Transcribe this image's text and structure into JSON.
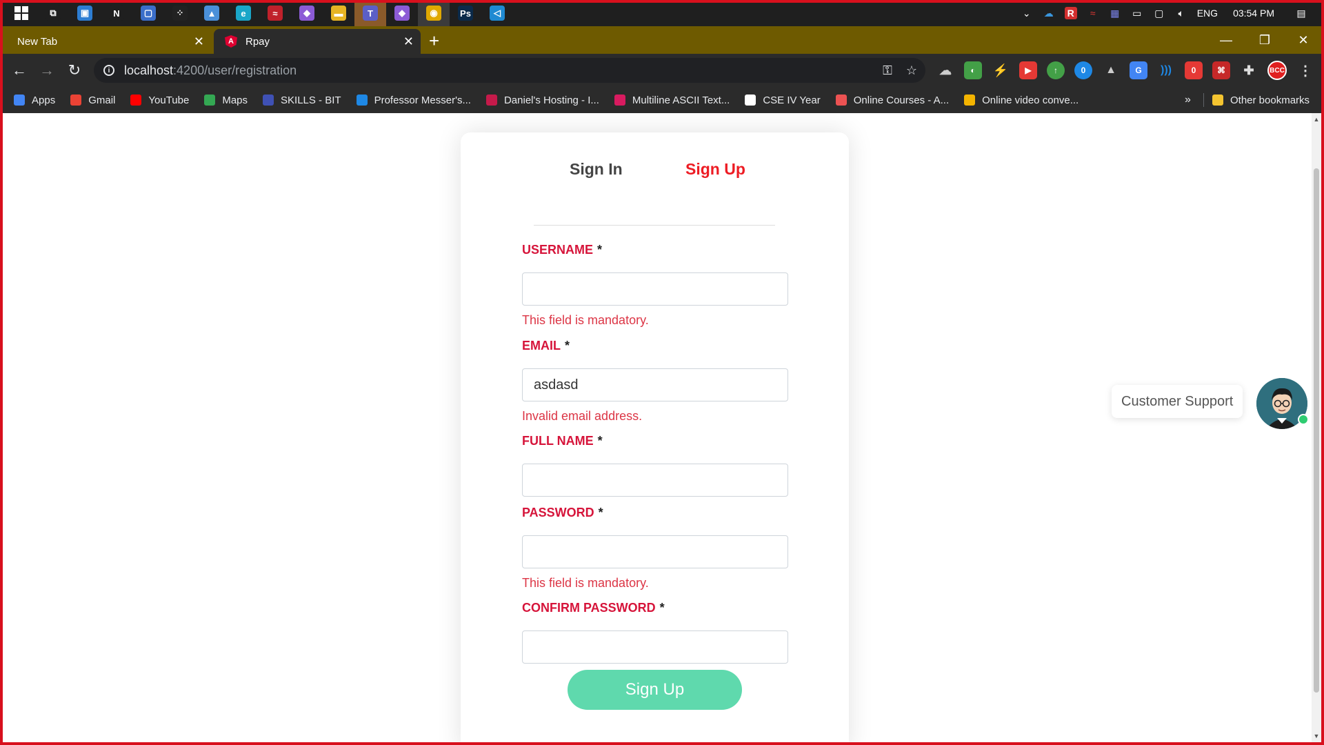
{
  "taskbar": {
    "apps": [
      {
        "icon": "task-view-icon",
        "color": "#1f1f1f",
        "glyph": "⧉"
      },
      {
        "icon": "app-blue-icon",
        "color": "#2d7dd2",
        "glyph": "▣"
      },
      {
        "icon": "notion-icon",
        "color": "#1f1f1f",
        "glyph": "N"
      },
      {
        "icon": "app-device-icon",
        "color": "#3b6ec9",
        "glyph": "▢"
      },
      {
        "icon": "blackberry-icon",
        "color": "#222",
        "glyph": "⁘"
      },
      {
        "icon": "photos-icon",
        "color": "#4a90d9",
        "glyph": "▲"
      },
      {
        "icon": "edge-icon",
        "color": "#1aa6c8",
        "glyph": "e"
      },
      {
        "icon": "app-red-icon",
        "color": "#c0212b",
        "glyph": "≈"
      },
      {
        "icon": "visual-studio-icon",
        "color": "#8c5bd6",
        "glyph": "◆"
      },
      {
        "icon": "file-explorer-icon",
        "color": "#e7b424",
        "glyph": "▬"
      },
      {
        "icon": "teams-icon",
        "color": "#5b5fc7",
        "glyph": "T"
      },
      {
        "icon": "visual-studio-icon",
        "color": "#8c5bd6",
        "glyph": "◆"
      },
      {
        "icon": "chrome-icon",
        "color": "#e0a800",
        "glyph": "◉"
      },
      {
        "icon": "photoshop-icon",
        "color": "#0b2a4a",
        "glyph": "Ps"
      },
      {
        "icon": "vscode-icon",
        "color": "#1f8ad2",
        "glyph": "◁"
      }
    ],
    "lang": "ENG",
    "time": "03:54 PM"
  },
  "browser": {
    "tabs": [
      {
        "title": "New Tab"
      },
      {
        "title": "Rpay"
      }
    ],
    "url_host": "localhost",
    "url_path": ":4200/user/registration",
    "bookmarks": [
      {
        "label": "Apps",
        "icon": "apps-grid-icon",
        "color": "#4285f4"
      },
      {
        "label": "Gmail",
        "icon": "gmail-icon",
        "color": "#ea4335"
      },
      {
        "label": "YouTube",
        "icon": "youtube-icon",
        "color": "#ff0000"
      },
      {
        "label": "Maps",
        "icon": "maps-icon",
        "color": "#34a853"
      },
      {
        "label": "SKILLS - BIT",
        "icon": "skills-icon",
        "color": "#3f51b5"
      },
      {
        "label": "Professor Messer's...",
        "icon": "messer-icon",
        "color": "#1e88e5"
      },
      {
        "label": "Daniel's Hosting - I...",
        "icon": "raspberry-icon",
        "color": "#c51a4a"
      },
      {
        "label": "Multiline ASCII Text...",
        "icon": "ascii-icon",
        "color": "#d81b60"
      },
      {
        "label": "CSE IV Year",
        "icon": "google-icon",
        "color": "#ffffff"
      },
      {
        "label": "Online Courses - A...",
        "icon": "udemy-icon",
        "color": "#ec5252"
      },
      {
        "label": "Online video conve...",
        "icon": "video-converter-icon",
        "color": "#f4b400"
      }
    ],
    "other_bookmarks": "Other bookmarks",
    "more": "»"
  },
  "form": {
    "tab_signin": "Sign In",
    "tab_signup": "Sign Up",
    "fields": [
      {
        "label": "USERNAME",
        "value": "",
        "error": "This field is mandatory."
      },
      {
        "label": "EMAIL",
        "value": "asdasd",
        "error": "Invalid email address."
      },
      {
        "label": "FULL NAME",
        "value": "",
        "error": ""
      },
      {
        "label": "PASSWORD",
        "value": "",
        "error": "This field is mandatory."
      },
      {
        "label": "CONFIRM PASSWORD",
        "value": "",
        "error": ""
      }
    ],
    "required_mark": "*",
    "submit_label": "Sign Up"
  },
  "support": {
    "label": "Customer Support"
  },
  "colors": {
    "accent_red": "#ed1c24",
    "label_red": "#d6143a",
    "error_red": "#dc3545",
    "button_green": "#5fd9ad",
    "tabstrip": "#6e5a00"
  }
}
